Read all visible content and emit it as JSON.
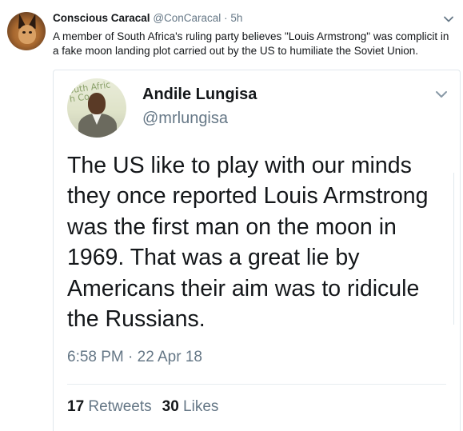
{
  "outer_tweet": {
    "display_name": "Conscious Caracal",
    "handle": "@ConCaracal",
    "separator": " · ",
    "time_ago": "5h",
    "text": "A member of South Africa's ruling party believes \"Louis Armstrong\" was complicit in a fake moon landing plot carried out by the US to humiliate the Soviet Union.",
    "avatar_icon": "caracal-avatar-icon",
    "menu_icon": "chevron-down-icon"
  },
  "quoted_tweet": {
    "display_name": "Andile Lungisa",
    "handle": "@mrlungisa",
    "avatar_icon": "profile-photo-avatar",
    "menu_icon": "chevron-down-icon",
    "text": "The US like to play with our minds they once reported Louis Armstrong was the first man on the moon in 1969. That was a great lie by Americans their aim was to ridicule the Russians.",
    "datetime": "6:58 PM · 22 Apr 18",
    "retweet_count": "17",
    "retweet_label": "Retweets",
    "like_count": "30",
    "like_label": "Likes"
  },
  "colors": {
    "primary_text": "#14171a",
    "secondary_text": "#657786",
    "border": "#e1e8ed"
  }
}
